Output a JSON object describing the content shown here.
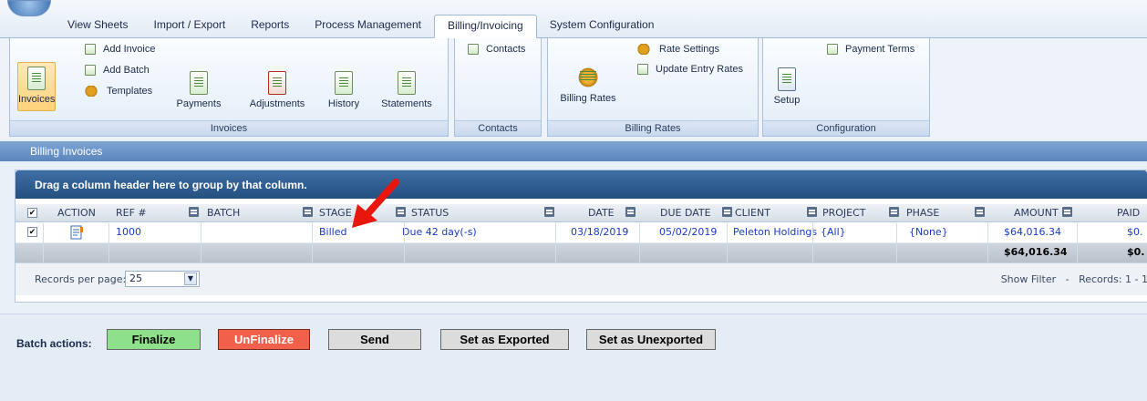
{
  "tabs": [
    "View Sheets",
    "Import / Export",
    "Reports",
    "Process Management",
    "Billing/Invoicing",
    "System Configuration"
  ],
  "active_tab": "Billing/Invoicing",
  "ribbon": {
    "invoices_group": {
      "label": "Invoices",
      "invoices": "Invoices",
      "add_invoice": "Add Invoice",
      "add_batch": "Add Batch",
      "templates": "Templates",
      "payments": "Payments",
      "adjustments": "Adjustments",
      "history": "History",
      "statements": "Statements"
    },
    "contacts_group": {
      "label": "Contacts",
      "contacts": "Contacts"
    },
    "billing_rates_group": {
      "label": "Billing Rates",
      "billing_rates": "Billing Rates",
      "rate_settings": "Rate Settings",
      "update_entry_rates": "Update Entry Rates"
    },
    "configuration_group": {
      "label": "Configuration",
      "payment_terms": "Payment Terms",
      "setup": "Setup"
    }
  },
  "section_title": "Billing Invoices",
  "grid": {
    "group_hint": "Drag a column header here to group by that column.",
    "columns": {
      "check": "✔",
      "action": "ACTION",
      "ref": "REF #",
      "batch": "BATCH",
      "stage": "STAGE",
      "status": "STATUS",
      "date": "DATE",
      "due_date": "DUE DATE",
      "client": "CLIENT",
      "project": "PROJECT",
      "phase": "PHASE",
      "amount": "AMOUNT",
      "paid": "PAID"
    },
    "row": {
      "check": "✔",
      "ref": "1000",
      "batch": "",
      "stage": "Billed",
      "status": "Due 42 day(-s)",
      "date": "03/18/2019",
      "due_date": "05/02/2019",
      "client": "Peleton Holdings",
      "project": "{All}",
      "phase": "{None}",
      "amount": "$64,016.34",
      "paid": "$0."
    },
    "totals": {
      "amount": "$64,016.34",
      "paid": "$0."
    },
    "pager": {
      "records_label": "Records per page:",
      "page_size": "25",
      "show_filter": "Show Filter",
      "separator": "-",
      "records_info": "Records: 1 - 1"
    }
  },
  "batch": {
    "label": "Batch actions:",
    "finalize": "Finalize",
    "unfinalize": "UnFinalize",
    "send": "Send",
    "set_exported": "Set as Exported",
    "set_unexported": "Set as Unexported"
  },
  "colors": {
    "finalize": "#8fe08a",
    "unfinalize": "#f0604a",
    "annotation_arrow": "#e8160c",
    "link": "#1a3ac8"
  }
}
